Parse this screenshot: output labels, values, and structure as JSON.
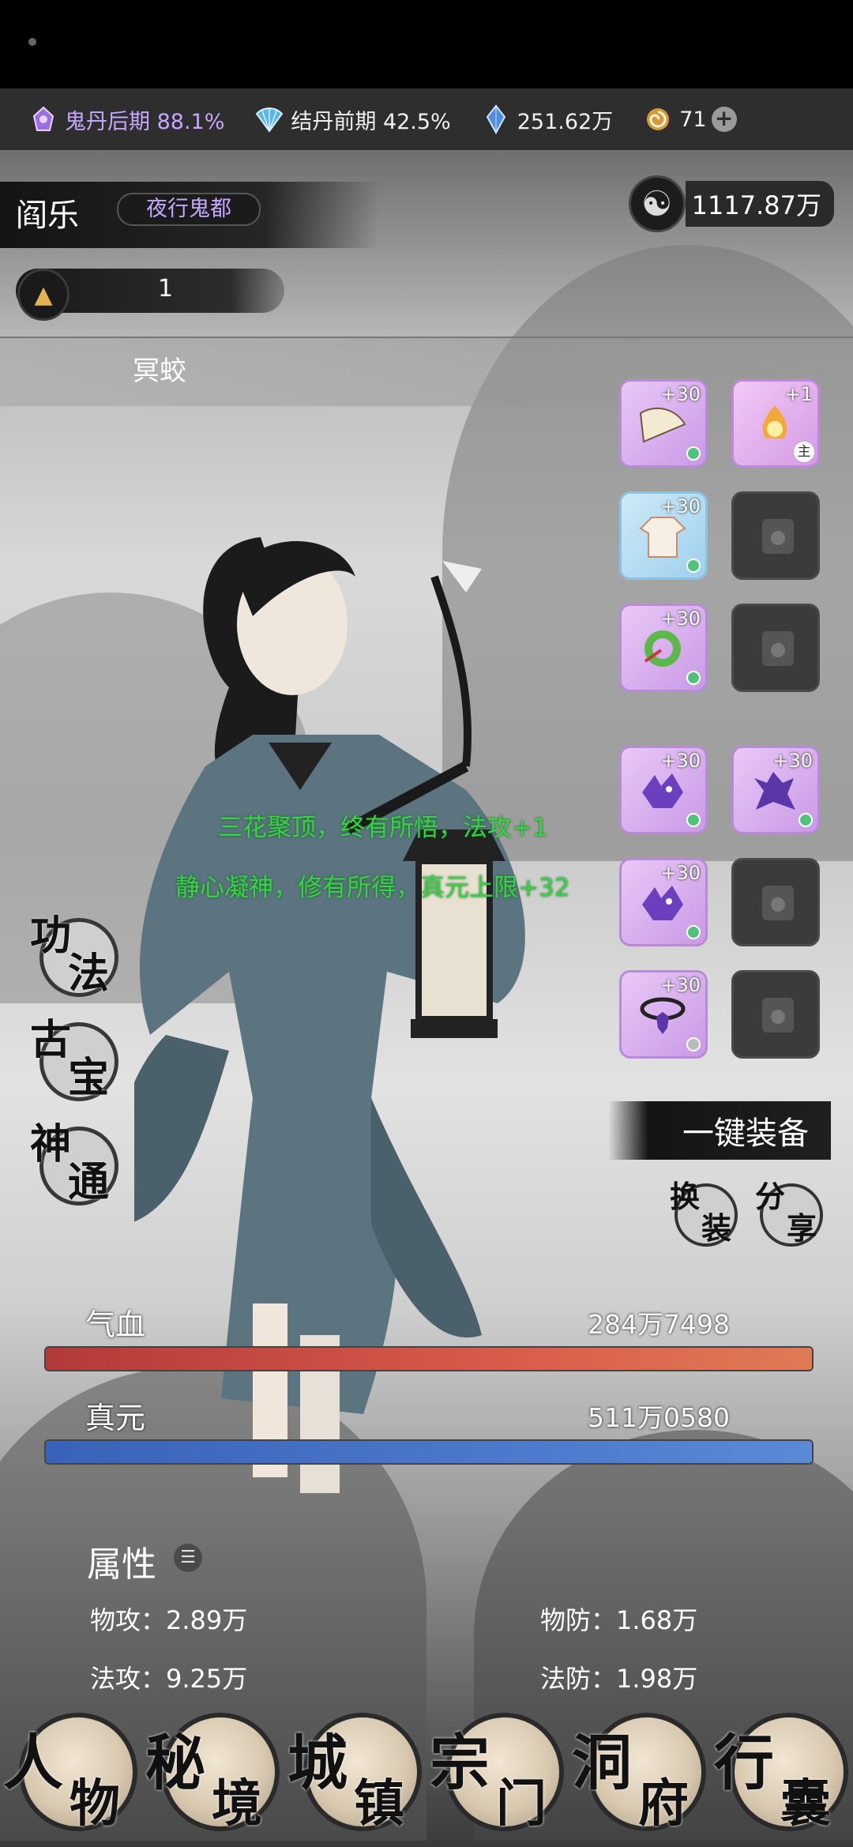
{
  "resources": {
    "guidan": {
      "icon": "ghost-core-icon",
      "text": "鬼丹后期 88.1%"
    },
    "jiedan": {
      "icon": "fan-icon",
      "text": "结丹前期 42.5%"
    },
    "spirit_stone": {
      "icon": "crystal-icon",
      "text": "251.62万"
    },
    "coins": {
      "icon": "swirl-coin-icon",
      "text": "71"
    }
  },
  "header": {
    "name": "阎乐",
    "title": "夜行鬼都",
    "power_icon": "yin-yang-icon",
    "power": "1117.87万",
    "level_icon": "rank-emblem-icon",
    "level": "1",
    "beast": "冥蛟"
  },
  "equipment": {
    "slots": [
      {
        "level": "+30",
        "art": "fan-item-icon"
      },
      {
        "level": "+1",
        "art": "flame-lotus-icon",
        "tag": "主"
      },
      {
        "level": "+30",
        "art": "robe-item-icon"
      },
      {
        "empty": true,
        "art": "locked-slot-icon"
      },
      {
        "level": "+30",
        "art": "jade-ring-icon"
      },
      {
        "empty": true,
        "art": "locked-slot-icon"
      },
      {
        "level": "+30",
        "art": "purple-beast-icon"
      },
      {
        "level": "+30",
        "art": "purple-dragon-icon"
      },
      {
        "level": "+30",
        "art": "purple-beast-icon"
      },
      {
        "empty": true,
        "art": "locked-slot-icon"
      },
      {
        "level": "+30",
        "art": "spiked-necklace-icon"
      },
      {
        "empty": true,
        "art": "locked-slot-icon"
      }
    ]
  },
  "messages": [
    "三花聚顶，终有所悟，法攻+1",
    "静心凝神，修有所得，真元上限+32"
  ],
  "side_menu": [
    {
      "c1": "功",
      "c2": "法"
    },
    {
      "c1": "古",
      "c2": "宝"
    },
    {
      "c1": "神",
      "c2": "通"
    }
  ],
  "actions": {
    "equip_all": "一键装备",
    "swap": {
      "c1": "换",
      "c2": "装"
    },
    "share": {
      "c1": "分",
      "c2": "享"
    }
  },
  "stats": {
    "hp_label": "气血",
    "hp_value": "284万7498",
    "hp_fill": 1.0,
    "mp_label": "真元",
    "mp_value": "511万0580",
    "mp_fill": 1.0
  },
  "attributes": {
    "title": "属性",
    "phys_atk": "物攻：2.89万",
    "phys_def": "物防：1.68万",
    "mag_atk": "法攻：9.25万",
    "mag_def": "法防：1.98万"
  },
  "nav": [
    {
      "c1": "人",
      "c2": "物"
    },
    {
      "c1": "秘",
      "c2": "境"
    },
    {
      "c1": "城",
      "c2": "镇"
    },
    {
      "c1": "宗",
      "c2": "门"
    },
    {
      "c1": "洞",
      "c2": "府"
    },
    {
      "c1": "行",
      "c2": "囊"
    }
  ],
  "colors": {
    "guidan": "#c8a6ff",
    "message_green": "#35d447",
    "hp_bar": "#d95b4b",
    "mp_bar": "#4c79cc",
    "slot_purple": "#d9b0f0",
    "slot_blue": "#a8d6ee"
  }
}
